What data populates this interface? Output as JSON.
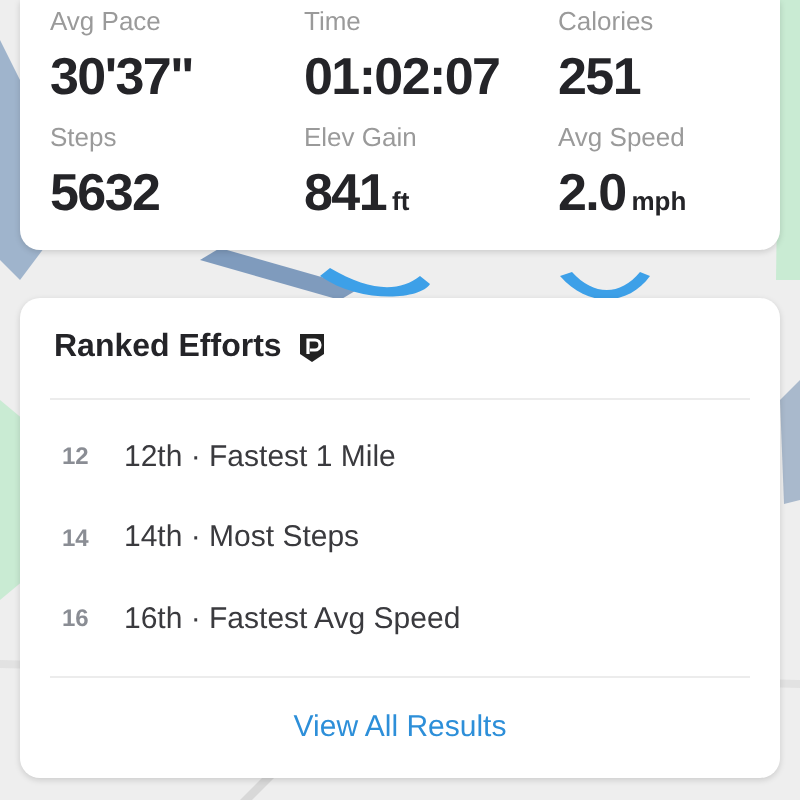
{
  "stats": [
    {
      "label": "Avg Pace",
      "value": "30'37\""
    },
    {
      "label": "Time",
      "value": "01:02:07"
    },
    {
      "label": "Calories",
      "value": "251"
    },
    {
      "label": "Steps",
      "value": "5632"
    },
    {
      "label": "Elev Gain",
      "value": "841",
      "unit": "ft"
    },
    {
      "label": "Avg Speed",
      "value": "2.0",
      "unit": "mph"
    }
  ],
  "ranked_efforts": {
    "title": "Ranked Efforts",
    "items": [
      {
        "rank": "12",
        "text": "12th · Fastest 1 Mile"
      },
      {
        "rank": "14",
        "text": "14th · Most Steps"
      },
      {
        "rank": "16",
        "text": "16th · Fastest Avg Speed"
      }
    ],
    "link": "View All Results"
  }
}
